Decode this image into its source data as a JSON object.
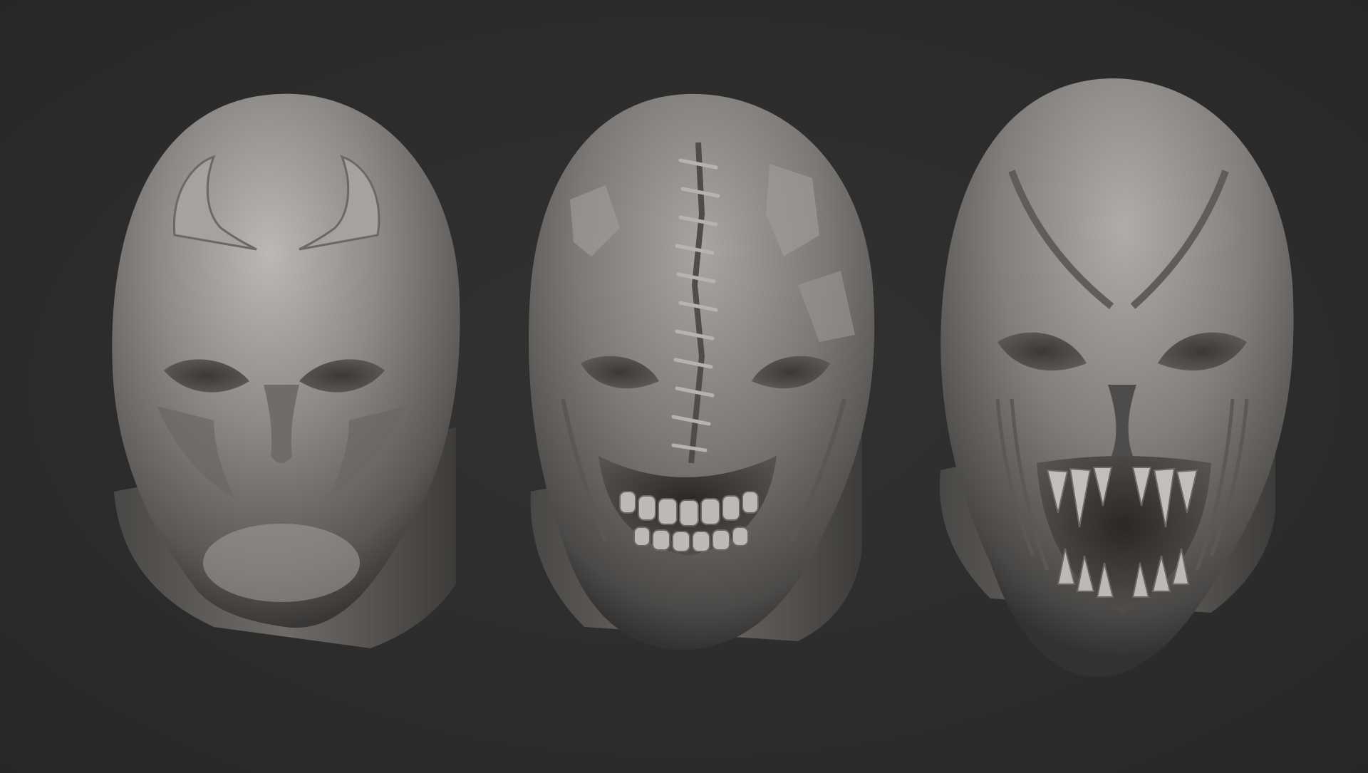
{
  "scene": {
    "background": "#2d2d2d",
    "material_base": "#8a8784",
    "material_highlight": "#bdbab6",
    "material_shadow": "#3a3836",
    "sculpts": [
      {
        "name": "smooth-symbiote-mask"
      },
      {
        "name": "scarred-stitched-mask"
      },
      {
        "name": "fanged-monster-mask"
      }
    ]
  }
}
